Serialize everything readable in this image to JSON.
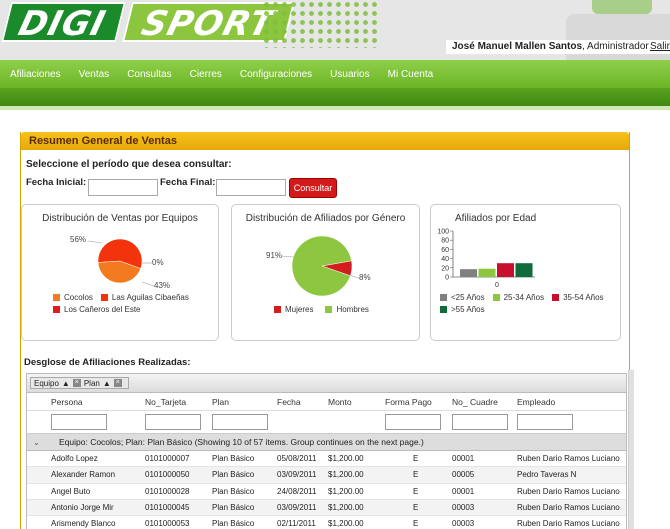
{
  "brand": {
    "part1": "DIGI",
    "part2": "SPORT"
  },
  "user": {
    "name": "José Manuel Mallen Santos",
    "role": ", Administrador",
    "logout": "Salir"
  },
  "nav": [
    "Afiliaciones",
    "Ventas",
    "Consultas",
    "Cierres",
    "Configuraciones",
    "Usuarios",
    "Mi Cuenta"
  ],
  "panel": {
    "title": "Resumen General de Ventas",
    "prompt": "Seleccione el período que desea consultar:",
    "fecha_inicial_label": "Fecha Inicial:",
    "fecha_inicial_value": "",
    "fecha_final_label": "Fecha Final:",
    "fecha_final_value": "",
    "consult_button": "Consultar"
  },
  "chart_data": [
    {
      "type": "pie",
      "title": "Distribución de Ventas por Equipos",
      "labels": [
        "Cocolos",
        "Las Aguilas Cibaeñas",
        "Los Cañeros del Este"
      ],
      "values": [
        43,
        56,
        0
      ],
      "data_labels": [
        "43%",
        "56%",
        "0%"
      ],
      "colors": [
        "#f47a1f",
        "#f2330c",
        "#e31b1b"
      ],
      "legend": "bottom"
    },
    {
      "type": "pie",
      "title": "Distribución de Afiliados por Género",
      "labels": [
        "Mujeres",
        "Hombres"
      ],
      "values": [
        8,
        91
      ],
      "data_labels": [
        "8%",
        "91%"
      ],
      "colors": [
        "#d21e1e",
        "#8dc63f"
      ],
      "legend": "bottom"
    },
    {
      "type": "bar",
      "title": "Afiliados por Edad",
      "categories": [
        "0"
      ],
      "series": [
        {
          "name": "<25 Años",
          "values": [
            17
          ]
        },
        {
          "name": "25-34 Años",
          "values": [
            18
          ]
        },
        {
          "name": "35-54 Años",
          "values": [
            30
          ]
        },
        {
          "name": ">55 Años",
          "values": [
            30
          ]
        }
      ],
      "colors": [
        "#808080",
        "#8dc63f",
        "#c8102e",
        "#0f6b3a"
      ],
      "yticks": [
        0,
        20,
        40,
        60,
        80,
        100
      ],
      "ylim": [
        0,
        100
      ],
      "legend": "bottom"
    }
  ],
  "grid": {
    "section_title": "Desglose de Afiliaciones Realizadas:",
    "group_chips": [
      "Equipo",
      "Plan"
    ],
    "columns": [
      "Persona",
      "No_Tarjeta",
      "Plan",
      "Fecha",
      "Monto",
      "Forma Pago",
      "No_ Cuadre",
      "Empleado"
    ],
    "group_label": "Equipo: Cocolos; Plan: Plan Básico (Showing 10 of 57 items. Group continues on the next page.)",
    "rows": [
      [
        "Adolfo Lopez",
        "0101000007",
        "Plan Básico",
        "05/08/2011",
        "$1,200.00",
        "E",
        "00001",
        "Ruben Dario Ramos Luciano"
      ],
      [
        "Alexander Ramon",
        "0101000050",
        "Plan Básico",
        "03/09/2011",
        "$1,200.00",
        "E",
        "00005",
        "Pedro Taveras N"
      ],
      [
        "Angel Buto",
        "0101000028",
        "Plan Básico",
        "24/08/2011",
        "$1,200.00",
        "E",
        "00001",
        "Ruben Dario Ramos Luciano"
      ],
      [
        "Antonio Jorge Mir",
        "0101000045",
        "Plan Básico",
        "03/09/2011",
        "$1,200.00",
        "E",
        "00003",
        "Ruben Dario Ramos Luciano"
      ],
      [
        "Arismendy Blanco",
        "0101000053",
        "Plan Básico",
        "02/11/2011",
        "$1,200.00",
        "E",
        "00003",
        "Ruben Dario Ramos Luciano"
      ]
    ]
  }
}
